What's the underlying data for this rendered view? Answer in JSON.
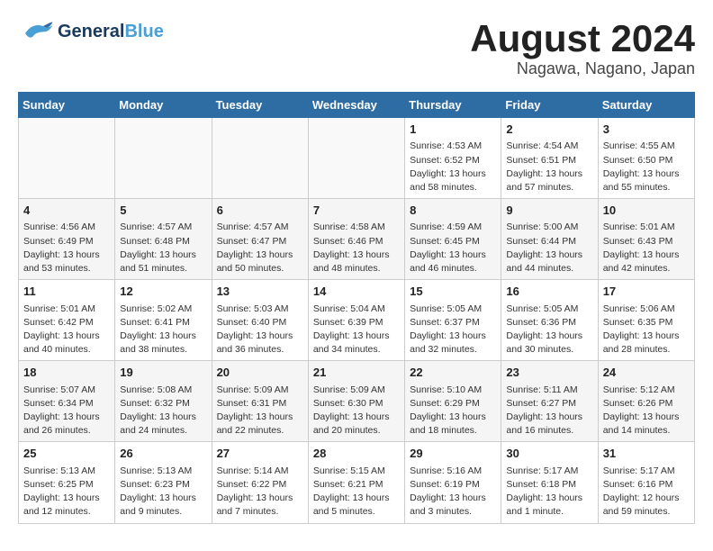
{
  "header": {
    "logo_general": "General",
    "logo_blue": "Blue",
    "month_title": "August 2024",
    "location": "Nagawa, Nagano, Japan"
  },
  "weekdays": [
    "Sunday",
    "Monday",
    "Tuesday",
    "Wednesday",
    "Thursday",
    "Friday",
    "Saturday"
  ],
  "weeks": [
    [
      {
        "day": "",
        "info": ""
      },
      {
        "day": "",
        "info": ""
      },
      {
        "day": "",
        "info": ""
      },
      {
        "day": "",
        "info": ""
      },
      {
        "day": "1",
        "info": "Sunrise: 4:53 AM\nSunset: 6:52 PM\nDaylight: 13 hours\nand 58 minutes."
      },
      {
        "day": "2",
        "info": "Sunrise: 4:54 AM\nSunset: 6:51 PM\nDaylight: 13 hours\nand 57 minutes."
      },
      {
        "day": "3",
        "info": "Sunrise: 4:55 AM\nSunset: 6:50 PM\nDaylight: 13 hours\nand 55 minutes."
      }
    ],
    [
      {
        "day": "4",
        "info": "Sunrise: 4:56 AM\nSunset: 6:49 PM\nDaylight: 13 hours\nand 53 minutes."
      },
      {
        "day": "5",
        "info": "Sunrise: 4:57 AM\nSunset: 6:48 PM\nDaylight: 13 hours\nand 51 minutes."
      },
      {
        "day": "6",
        "info": "Sunrise: 4:57 AM\nSunset: 6:47 PM\nDaylight: 13 hours\nand 50 minutes."
      },
      {
        "day": "7",
        "info": "Sunrise: 4:58 AM\nSunset: 6:46 PM\nDaylight: 13 hours\nand 48 minutes."
      },
      {
        "day": "8",
        "info": "Sunrise: 4:59 AM\nSunset: 6:45 PM\nDaylight: 13 hours\nand 46 minutes."
      },
      {
        "day": "9",
        "info": "Sunrise: 5:00 AM\nSunset: 6:44 PM\nDaylight: 13 hours\nand 44 minutes."
      },
      {
        "day": "10",
        "info": "Sunrise: 5:01 AM\nSunset: 6:43 PM\nDaylight: 13 hours\nand 42 minutes."
      }
    ],
    [
      {
        "day": "11",
        "info": "Sunrise: 5:01 AM\nSunset: 6:42 PM\nDaylight: 13 hours\nand 40 minutes."
      },
      {
        "day": "12",
        "info": "Sunrise: 5:02 AM\nSunset: 6:41 PM\nDaylight: 13 hours\nand 38 minutes."
      },
      {
        "day": "13",
        "info": "Sunrise: 5:03 AM\nSunset: 6:40 PM\nDaylight: 13 hours\nand 36 minutes."
      },
      {
        "day": "14",
        "info": "Sunrise: 5:04 AM\nSunset: 6:39 PM\nDaylight: 13 hours\nand 34 minutes."
      },
      {
        "day": "15",
        "info": "Sunrise: 5:05 AM\nSunset: 6:37 PM\nDaylight: 13 hours\nand 32 minutes."
      },
      {
        "day": "16",
        "info": "Sunrise: 5:05 AM\nSunset: 6:36 PM\nDaylight: 13 hours\nand 30 minutes."
      },
      {
        "day": "17",
        "info": "Sunrise: 5:06 AM\nSunset: 6:35 PM\nDaylight: 13 hours\nand 28 minutes."
      }
    ],
    [
      {
        "day": "18",
        "info": "Sunrise: 5:07 AM\nSunset: 6:34 PM\nDaylight: 13 hours\nand 26 minutes."
      },
      {
        "day": "19",
        "info": "Sunrise: 5:08 AM\nSunset: 6:32 PM\nDaylight: 13 hours\nand 24 minutes."
      },
      {
        "day": "20",
        "info": "Sunrise: 5:09 AM\nSunset: 6:31 PM\nDaylight: 13 hours\nand 22 minutes."
      },
      {
        "day": "21",
        "info": "Sunrise: 5:09 AM\nSunset: 6:30 PM\nDaylight: 13 hours\nand 20 minutes."
      },
      {
        "day": "22",
        "info": "Sunrise: 5:10 AM\nSunset: 6:29 PM\nDaylight: 13 hours\nand 18 minutes."
      },
      {
        "day": "23",
        "info": "Sunrise: 5:11 AM\nSunset: 6:27 PM\nDaylight: 13 hours\nand 16 minutes."
      },
      {
        "day": "24",
        "info": "Sunrise: 5:12 AM\nSunset: 6:26 PM\nDaylight: 13 hours\nand 14 minutes."
      }
    ],
    [
      {
        "day": "25",
        "info": "Sunrise: 5:13 AM\nSunset: 6:25 PM\nDaylight: 13 hours\nand 12 minutes."
      },
      {
        "day": "26",
        "info": "Sunrise: 5:13 AM\nSunset: 6:23 PM\nDaylight: 13 hours\nand 9 minutes."
      },
      {
        "day": "27",
        "info": "Sunrise: 5:14 AM\nSunset: 6:22 PM\nDaylight: 13 hours\nand 7 minutes."
      },
      {
        "day": "28",
        "info": "Sunrise: 5:15 AM\nSunset: 6:21 PM\nDaylight: 13 hours\nand 5 minutes."
      },
      {
        "day": "29",
        "info": "Sunrise: 5:16 AM\nSunset: 6:19 PM\nDaylight: 13 hours\nand 3 minutes."
      },
      {
        "day": "30",
        "info": "Sunrise: 5:17 AM\nSunset: 6:18 PM\nDaylight: 13 hours\nand 1 minute."
      },
      {
        "day": "31",
        "info": "Sunrise: 5:17 AM\nSunset: 6:16 PM\nDaylight: 12 hours\nand 59 minutes."
      }
    ]
  ]
}
